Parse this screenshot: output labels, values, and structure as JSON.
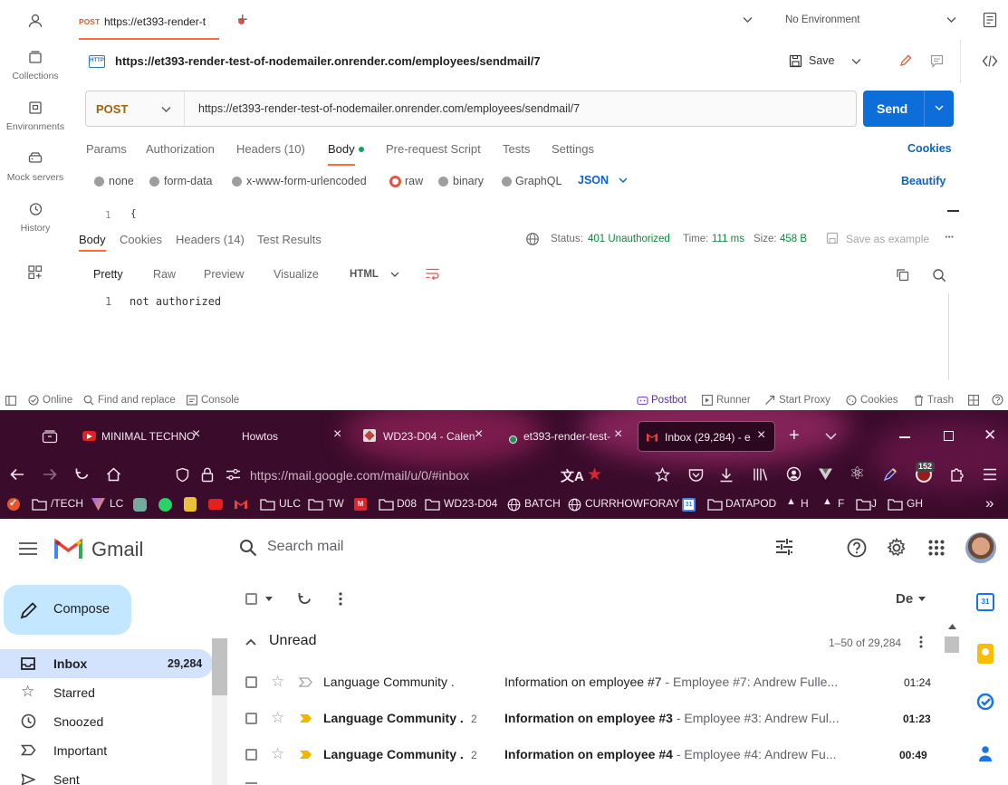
{
  "postman": {
    "sidebar": [
      {
        "key": "account",
        "label": ""
      },
      {
        "key": "collections",
        "label": "Collections"
      },
      {
        "key": "environments",
        "label": "Environments"
      },
      {
        "key": "mock",
        "label": "Mock servers"
      },
      {
        "key": "history",
        "label": "History"
      },
      {
        "key": "more",
        "label": ""
      }
    ],
    "tab": {
      "method": "POST",
      "title": "https://et393-render-t"
    },
    "environment": "No Environment",
    "request_title": "https://et393-render-test-of-nodemailer.onrender.com/employees/sendmail/7",
    "save_label": "Save",
    "method": "POST",
    "url": "https://et393-render-test-of-nodemailer.onrender.com/employees/sendmail/7",
    "send_label": "Send",
    "req_tabs": [
      "Params",
      "Authorization",
      "Headers (10)",
      "Body",
      "Pre-request Script",
      "Tests",
      "Settings"
    ],
    "cookies_link": "Cookies",
    "body_types": [
      "none",
      "form-data",
      "x-www-form-urlencoded",
      "raw",
      "binary",
      "GraphQL"
    ],
    "body_format": "JSON",
    "beautify": "Beautify",
    "editor_line": "1",
    "editor_text": "{",
    "res_tabs": [
      "Body",
      "Cookies",
      "Headers (14)",
      "Test Results"
    ],
    "status_label": "Status:",
    "status_value": "401 Unauthorized",
    "time_label": "Time:",
    "time_value": "111 ms",
    "size_label": "Size:",
    "size_value": "458 B",
    "save_example": "Save as example",
    "view_tabs": [
      "Pretty",
      "Raw",
      "Preview",
      "Visualize"
    ],
    "view_format": "HTML",
    "response_line": "1",
    "response_text": "not authorized",
    "statusbar": {
      "online": "Online",
      "find": "Find and replace",
      "console": "Console",
      "postbot": "Postbot",
      "runner": "Runner",
      "proxy": "Start Proxy",
      "cookies": "Cookies",
      "trash": "Trash"
    },
    "colors": {
      "accent": "#ff6c37",
      "send": "#0d6ed9",
      "status": "#0a8a3a"
    }
  },
  "browser": {
    "tabs": [
      {
        "title": "MINIMAL TECHNO",
        "icon": "youtube-icon"
      },
      {
        "title": "Howtos",
        "icon": ""
      },
      {
        "title": "WD23-D04 - Calen",
        "icon": "calendar-icon"
      },
      {
        "title": "et393-render-test-",
        "icon": "postman-icon"
      },
      {
        "title": "Inbox (29,284) - e",
        "icon": "gmail-icon"
      }
    ],
    "url": "https://mail.google.com/mail/u/0/#inbox",
    "badge": "152",
    "bookmarks": [
      "/TECH",
      "LC",
      "ULC",
      "TW",
      "D08",
      "WD23-D04",
      "BATCH",
      "CURRHOWFORAY",
      "DATAPOD",
      "H",
      "F",
      "J",
      "GH"
    ]
  },
  "gmail": {
    "brand": "Gmail",
    "search_placeholder": "Search mail",
    "compose": "Compose",
    "nav": [
      {
        "label": "Inbox",
        "count": "29,284"
      },
      {
        "label": "Starred",
        "count": ""
      },
      {
        "label": "Snoozed",
        "count": ""
      },
      {
        "label": "Important",
        "count": ""
      },
      {
        "label": "Sent",
        "count": ""
      }
    ],
    "lang": "De",
    "section": "Unread",
    "range": "1–50 of 29,284",
    "emails": [
      {
        "sender": "Language Community .",
        "count": "",
        "subject": "Information on employee #7",
        "snippet": " - Employee #7: Andrew Fulle...",
        "time": "01:24",
        "unread": false
      },
      {
        "sender": "Language Community .",
        "count": "2",
        "subject": "Information on employee #3",
        "snippet": " - Employee #3: Andrew Ful...",
        "time": "01:23",
        "unread": true
      },
      {
        "sender": "Language Community .",
        "count": "2",
        "subject": "Information on employee #4",
        "snippet": " - Employee #4: Andrew Fu...",
        "time": "00:49",
        "unread": true
      }
    ]
  }
}
